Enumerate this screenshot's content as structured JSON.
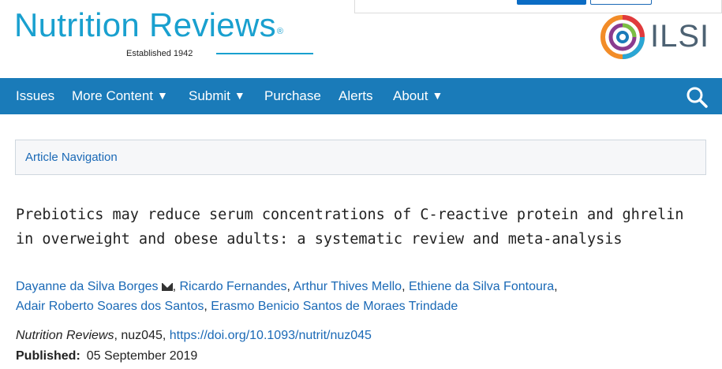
{
  "journal": {
    "name": "Nutrition Reviews",
    "registered_mark": "®",
    "established": "Established 1942",
    "brand_color": "#19a0cf"
  },
  "partner": {
    "name": "ILSI"
  },
  "nav": {
    "bg_color": "#1a7bb9",
    "items": [
      {
        "label": "Issues",
        "dropdown": false
      },
      {
        "label": "More Content",
        "dropdown": true
      },
      {
        "label": "Submit",
        "dropdown": true
      },
      {
        "label": "Purchase",
        "dropdown": false
      },
      {
        "label": "Alerts",
        "dropdown": false
      },
      {
        "label": "About",
        "dropdown": true
      }
    ],
    "caret": "▼",
    "search_icon": "search-icon"
  },
  "article_navigation": {
    "label": "Article Navigation"
  },
  "article": {
    "title": "Prebiotics may reduce serum concentrations of C-reactive protein and ghrelin in overweight and obese adults: a systematic review and meta-analysis",
    "authors": [
      {
        "name": "Dayanne da Silva Borges",
        "corresponding": true
      },
      {
        "name": "Ricardo Fernandes"
      },
      {
        "name": "Arthur Thives Mello"
      },
      {
        "name": "Ethiene da Silva Fontoura"
      },
      {
        "name": "Adair Roberto Soares dos Santos"
      },
      {
        "name": "Erasmo Benicio Santos de Moraes Trindade"
      }
    ],
    "author_separator": ", ",
    "citation": {
      "journal": "Nutrition Reviews",
      "separator": ", ",
      "id": "nuz045",
      "doi": "https://doi.org/10.1093/nutrit/nuz045"
    },
    "published_label": "Published:",
    "published_date": "05 September 2019"
  },
  "link_color": "#1a69b6"
}
